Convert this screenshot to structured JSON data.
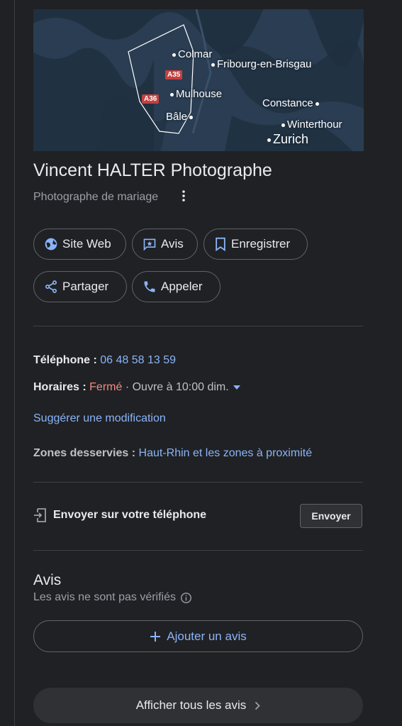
{
  "map": {
    "cities": {
      "colmar": "Colmar",
      "fribourg": "Fribourg-en-Brisgau",
      "mulhouse": "Mulhouse",
      "bale": "Bâle",
      "constance": "Constance",
      "winterthour": "Winterthour",
      "zurich": "Zurich"
    },
    "roads": {
      "a35": "A35",
      "a36": "A36"
    },
    "colors": {
      "water_bg": "#2a3d52",
      "land": "#1f3040",
      "boundary": "#ffffff",
      "road_badge": "#c5413f"
    }
  },
  "business": {
    "name": "Vincent HALTER Photographe",
    "category": "Photographe de mariage",
    "more_icon": "more-vert-icon"
  },
  "actions": {
    "website": {
      "label": "Site Web",
      "icon": "globe-icon"
    },
    "reviews": {
      "label": "Avis",
      "icon": "review-star-icon"
    },
    "save": {
      "label": "Enregistrer",
      "icon": "bookmark-icon"
    },
    "share": {
      "label": "Partager",
      "icon": "share-icon"
    },
    "call": {
      "label": "Appeler",
      "icon": "phone-icon"
    }
  },
  "details": {
    "phone_label": "Téléphone :",
    "phone_value": "06 48 58 13 59",
    "hours_label": "Horaires :",
    "hours_status": "Fermé",
    "hours_next": " · Ouvre à 10:00 dim.",
    "suggest_edit": "Suggérer une modification",
    "zones_label": "Zones desservies :",
    "zones_value": "Haut-Rhin et les zones à proximité"
  },
  "send_to_phone": {
    "label": "Envoyer sur votre téléphone",
    "button": "Envoyer",
    "icon": "send-to-phone-icon"
  },
  "reviews": {
    "title": "Avis",
    "subtitle": "Les avis ne sont pas vérifiés",
    "info_icon": "info-icon",
    "add_label": "Ajouter un avis",
    "all_label": "Afficher tous les avis"
  },
  "colors": {
    "accent_link": "#8ab4f8",
    "closed": "#f28b82",
    "background": "#202124"
  }
}
